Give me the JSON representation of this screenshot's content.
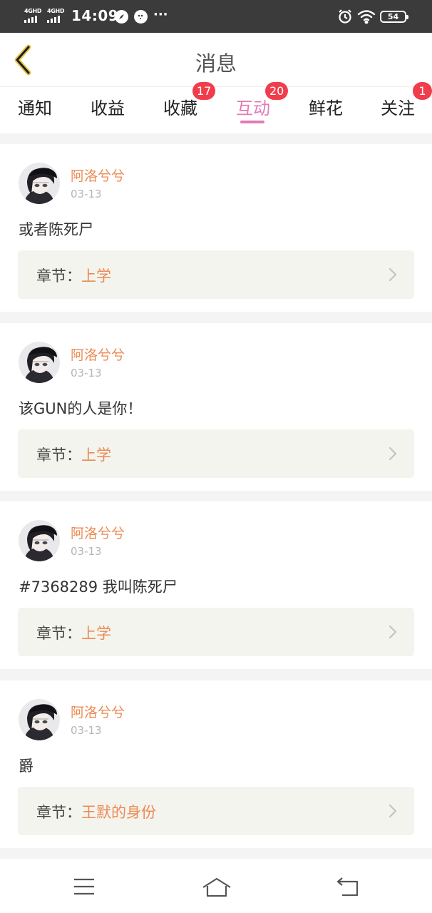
{
  "status_bar": {
    "network_1": "4GHD",
    "network_2": "4GHD",
    "time": "14:09",
    "more": "···",
    "battery": "54"
  },
  "header": {
    "title": "消息",
    "back_icon": "chevron-left-icon"
  },
  "tabs": [
    {
      "label": "通知",
      "badge": null,
      "active": false
    },
    {
      "label": "收益",
      "badge": null,
      "active": false
    },
    {
      "label": "收藏",
      "badge": "17",
      "active": false
    },
    {
      "label": "互动",
      "badge": "20",
      "active": true
    },
    {
      "label": "鲜花",
      "badge": null,
      "active": false
    },
    {
      "label": "关注",
      "badge": "1",
      "active": false
    }
  ],
  "colors": {
    "accent": "#e27ab6",
    "username": "#ec8a54",
    "badge": "#f13c4c",
    "chapter_bg": "#f4f4ee"
  },
  "messages": [
    {
      "user": "阿洛兮兮",
      "date": "03-13",
      "content": "或者陈死尸",
      "chapter_label": "章节：",
      "chapter_name": "上学"
    },
    {
      "user": "阿洛兮兮",
      "date": "03-13",
      "content": "该GUN的人是你！",
      "chapter_label": "章节：",
      "chapter_name": "上学"
    },
    {
      "user": "阿洛兮兮",
      "date": "03-13",
      "content": "#7368289 我叫陈死尸",
      "chapter_label": "章节：",
      "chapter_name": "上学"
    },
    {
      "user": "阿洛兮兮",
      "date": "03-13",
      "content": "爵",
      "chapter_label": "章节：",
      "chapter_name": "王默的身份"
    }
  ],
  "nav_bar": {
    "items": [
      "menu-icon",
      "home-icon",
      "back-icon"
    ]
  }
}
